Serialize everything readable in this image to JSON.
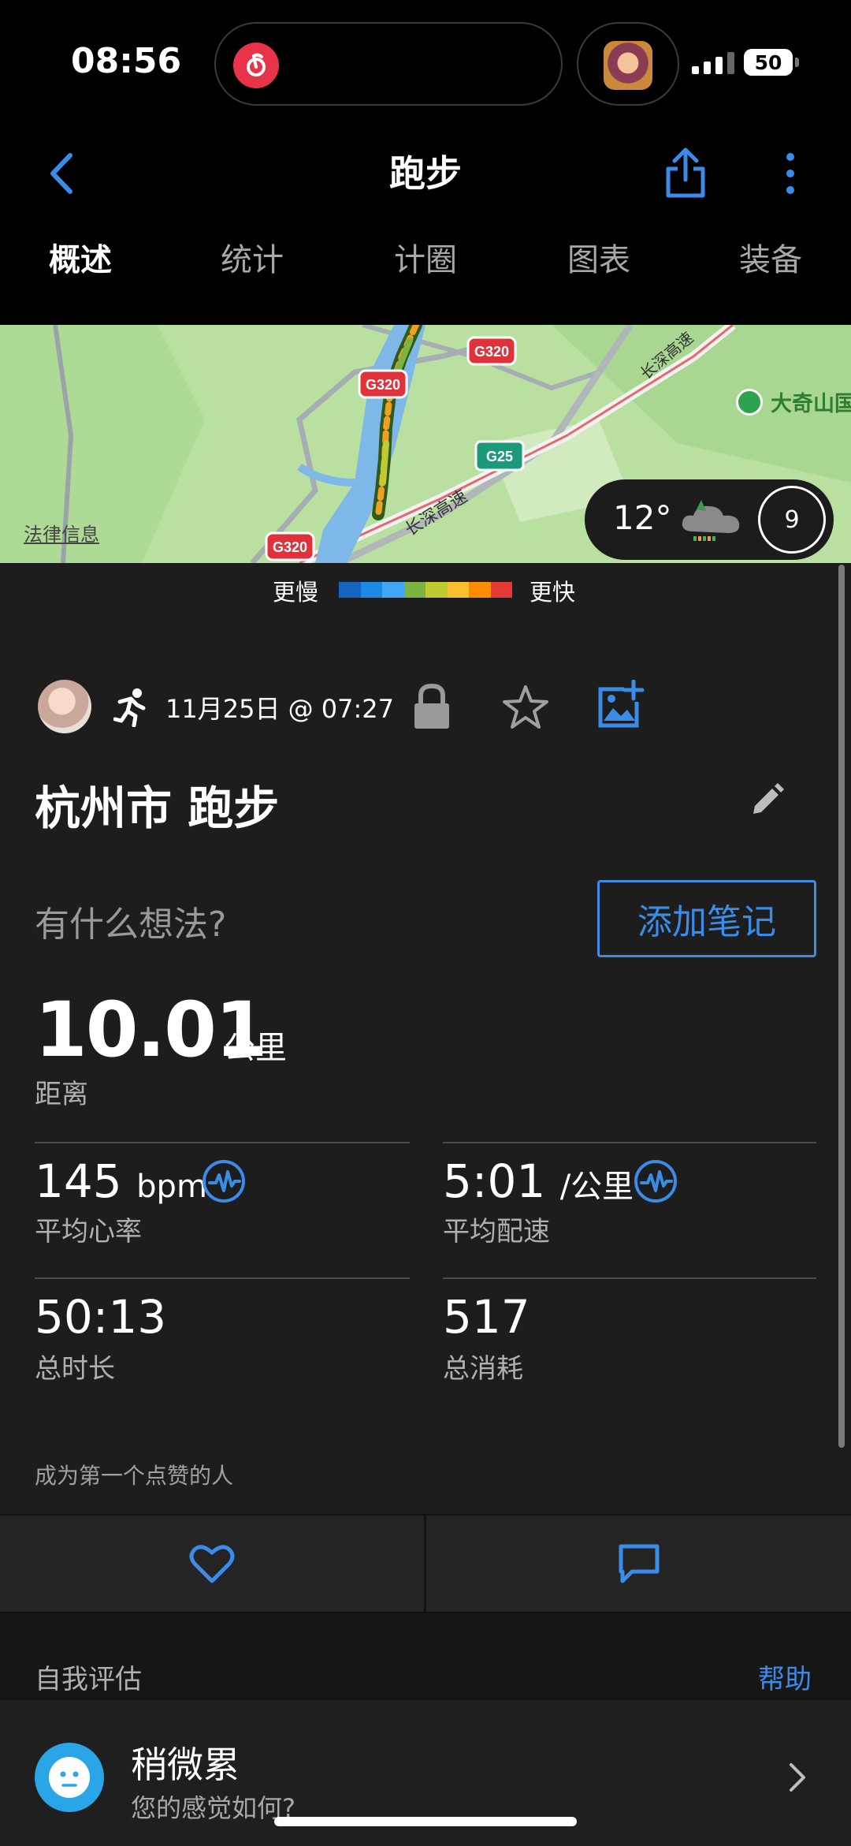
{
  "status_bar": {
    "time": "08:56",
    "battery": "50"
  },
  "header": {
    "title": "跑步",
    "tabs": [
      {
        "label": "概述",
        "active": true
      },
      {
        "label": "统计",
        "active": false
      },
      {
        "label": "计圈",
        "active": false
      },
      {
        "label": "图表",
        "active": false
      },
      {
        "label": "装备",
        "active": false
      }
    ]
  },
  "map": {
    "legal": "法律信息",
    "poi": "大奇山国",
    "road_labels": [
      "G320",
      "G320",
      "G320",
      "G25",
      "长深高速",
      "长深高速"
    ],
    "weather": {
      "temp": "12°",
      "wind": "9"
    }
  },
  "pace_legend": {
    "slow": "更慢",
    "fast": "更快",
    "colors": [
      "#1565c0",
      "#1e88e5",
      "#42a5f5",
      "#7cb342",
      "#c0ca33",
      "#fbc02d",
      "#fb8c00",
      "#e53935"
    ]
  },
  "activity": {
    "datetime": "11月25日 @ 07:27",
    "title": "杭州市 跑步",
    "thoughts_prompt": "有什么想法?",
    "add_note": "添加笔记"
  },
  "stats": {
    "distance": {
      "value": "10.01",
      "unit": "公里",
      "label": "距离"
    },
    "heart_rate": {
      "value": "145",
      "unit": "bpm",
      "label": "平均心率"
    },
    "pace": {
      "value": "5:01",
      "unit": "/公里",
      "label": "平均配速"
    },
    "duration": {
      "value": "50:13",
      "label": "总时长"
    },
    "calories": {
      "value": "517",
      "label": "总消耗"
    }
  },
  "social": {
    "first_like": "成为第一个点赞的人"
  },
  "self_eval": {
    "label": "自我评估",
    "help": "帮助",
    "feeling": "稍微累",
    "feeling_prompt": "您的感觉如何?"
  },
  "colors": {
    "accent": "#3a8ce8",
    "background": "#1d1d1d"
  }
}
